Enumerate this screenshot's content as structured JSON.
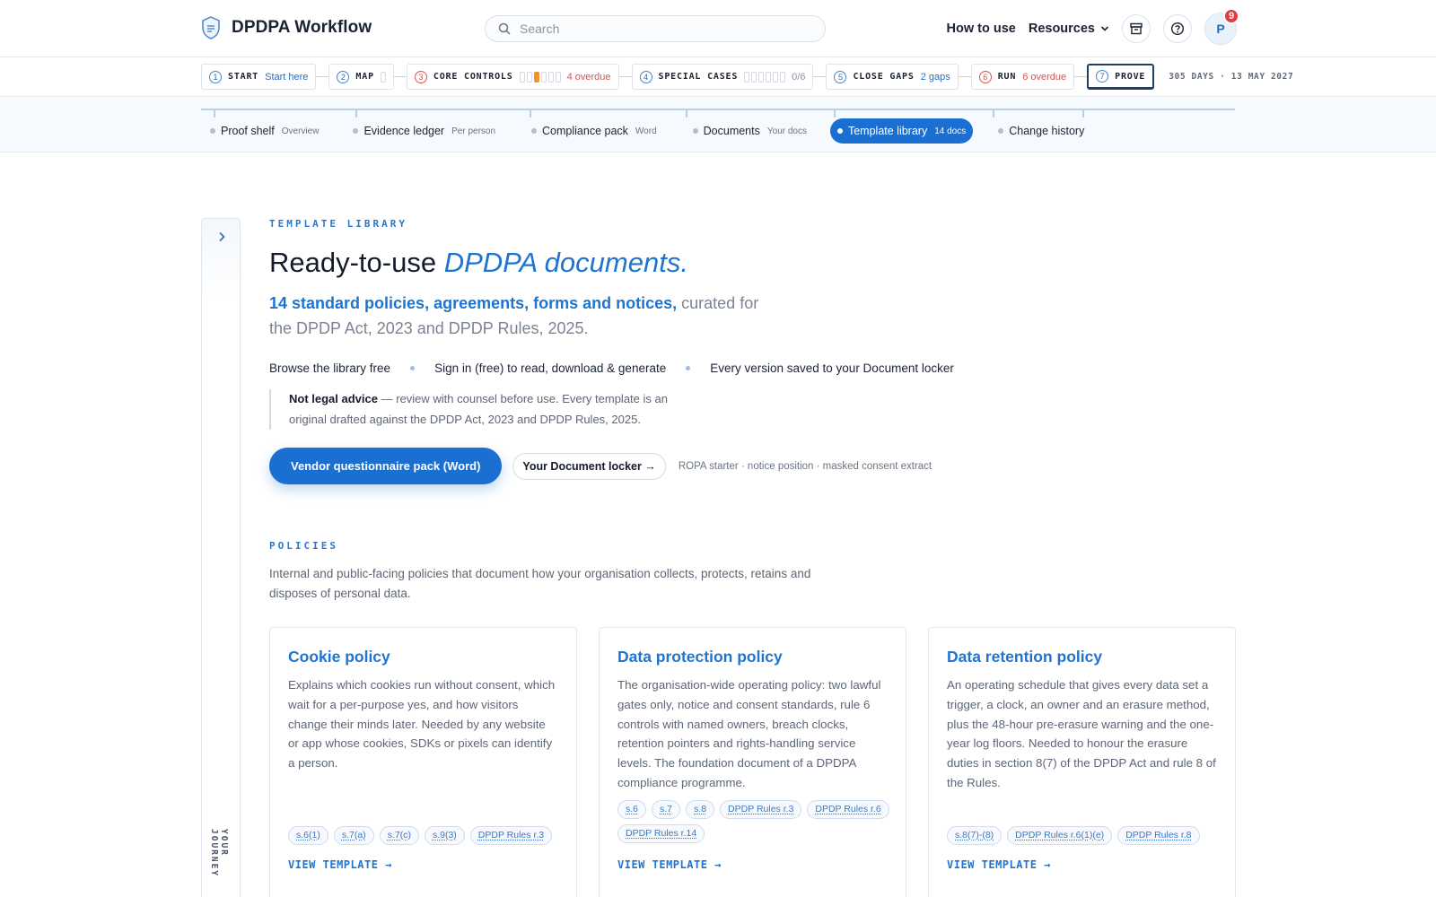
{
  "header": {
    "brand": "DPDPA Workflow",
    "search_placeholder": "Search",
    "how_to_use": "How to use",
    "resources": "Resources",
    "avatar_initial": "P",
    "notification_count": "9"
  },
  "steps": [
    {
      "num": "1",
      "label": "START",
      "sub": "Start here"
    },
    {
      "num": "2",
      "label": "MAP",
      "sub": ""
    },
    {
      "num": "3",
      "label": "CORE CONTROLS",
      "sub": "4 overdue"
    },
    {
      "num": "4",
      "label": "SPECIAL CASES",
      "sub": "0/6"
    },
    {
      "num": "5",
      "label": "CLOSE GAPS",
      "sub": "2 gaps"
    },
    {
      "num": "6",
      "label": "RUN",
      "sub": "6 overdue"
    },
    {
      "num": "7",
      "label": "PROVE",
      "sub": ""
    }
  ],
  "deadline": "305 DAYS · 13 MAY 2027",
  "subnav": [
    {
      "label": "Proof shelf",
      "sub": "Overview"
    },
    {
      "label": "Evidence ledger",
      "sub": "Per person"
    },
    {
      "label": "Compliance pack",
      "sub": "Word"
    },
    {
      "label": "Documents",
      "sub": "Your docs"
    },
    {
      "label": "Template library",
      "sub": "14 docs"
    },
    {
      "label": "Change history",
      "sub": ""
    }
  ],
  "rail_label": "YOUR JOURNEY",
  "hero": {
    "eyebrow": "TEMPLATE LIBRARY",
    "title_plain": "Ready-to-use ",
    "title_em": "DPDPA documents.",
    "sub_strong": "14 standard policies, agreements, forms and notices,",
    "sub_rest": " curated for the DPDP Act, 2023 and DPDP Rules, 2025.",
    "features": [
      "Browse the library free",
      "Sign in (free) to read, download & generate",
      "Every version saved to your Document locker"
    ],
    "disclaimer_strong": "Not legal advice",
    "disclaimer_rest": " — review with counsel before use. Every template is an original drafted against the DPDP Act, 2023 and DPDP Rules, 2025.",
    "primary_cta": "Vendor questionnaire pack (Word)",
    "secondary_cta": "Your Document locker →",
    "cta_meta": "ROPA starter · notice position · masked consent extract"
  },
  "policies": {
    "eyebrow": "POLICIES",
    "desc": "Internal and public-facing policies that document how your organisation collects, protects, retains and disposes of personal data.",
    "view_label": "VIEW TEMPLATE →",
    "cards": [
      {
        "title": "Cookie policy",
        "desc": "Explains which cookies run without consent, which wait for a per-purpose yes, and how visitors change their minds later. Needed by any website or app whose cookies, SDKs or pixels can identify a person.",
        "tags": [
          "s.6(1)",
          "s.7(a)",
          "s.7(c)",
          "s.9(3)",
          "DPDP Rules r.3"
        ]
      },
      {
        "title": "Data protection policy",
        "desc": "The organisation-wide operating policy: two lawful gates only, notice and consent standards, rule 6 controls with named owners, breach clocks, retention pointers and rights-handling service levels. The foundation document of a DPDPA compliance programme.",
        "tags": [
          "s.6",
          "s.7",
          "s.8",
          "DPDP Rules r.3",
          "DPDP Rules r.6",
          "DPDP Rules r.14"
        ]
      },
      {
        "title": "Data retention policy",
        "desc": "An operating schedule that gives every data set a trigger, a clock, an owner and an erasure method, plus the 48-hour pre-erasure warning and the one-year log floors. Needed to honour the erasure duties in section 8(7) of the DPDP Act and rule 8 of the Rules.",
        "tags": [
          "s.8(7)-(8)",
          "DPDP Rules r.6(1)(e)",
          "DPDP Rules r.8"
        ]
      }
    ]
  },
  "colors": {
    "accent": "#1a6fd1",
    "overdue": "#d9534f",
    "progress": "#f0932b"
  }
}
